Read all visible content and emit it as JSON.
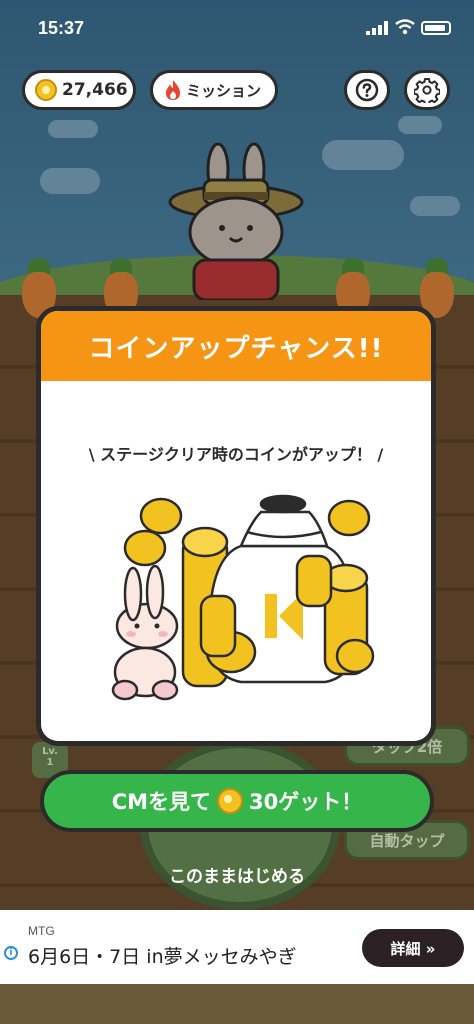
{
  "status_bar": {
    "time": "15:37"
  },
  "hud": {
    "coins": "27,466",
    "mission_label": "ミッション",
    "help_icon": "question-icon",
    "settings_icon": "gear-icon"
  },
  "background": {
    "level_badge_line1": "Lv.",
    "level_badge_line2": "1",
    "tap_double_label": "タップ2倍",
    "auto_tap_label": "自動タップ"
  },
  "modal": {
    "title": "コインアップチャンス!!",
    "subtitle": "\\ ステージクリア時のコインがアップ！ /"
  },
  "cta": {
    "prefix": "CMを見て",
    "amount": "30ゲット！"
  },
  "skip_label": "このままはじめる",
  "ad": {
    "brand": "MTG",
    "headline": "6月6日・7日 in夢メッセみやぎ",
    "button_label": "詳細 »"
  },
  "colors": {
    "modal_header": "#f59513",
    "cta_green": "#36b54a",
    "coin_gold": "#f2c320"
  }
}
